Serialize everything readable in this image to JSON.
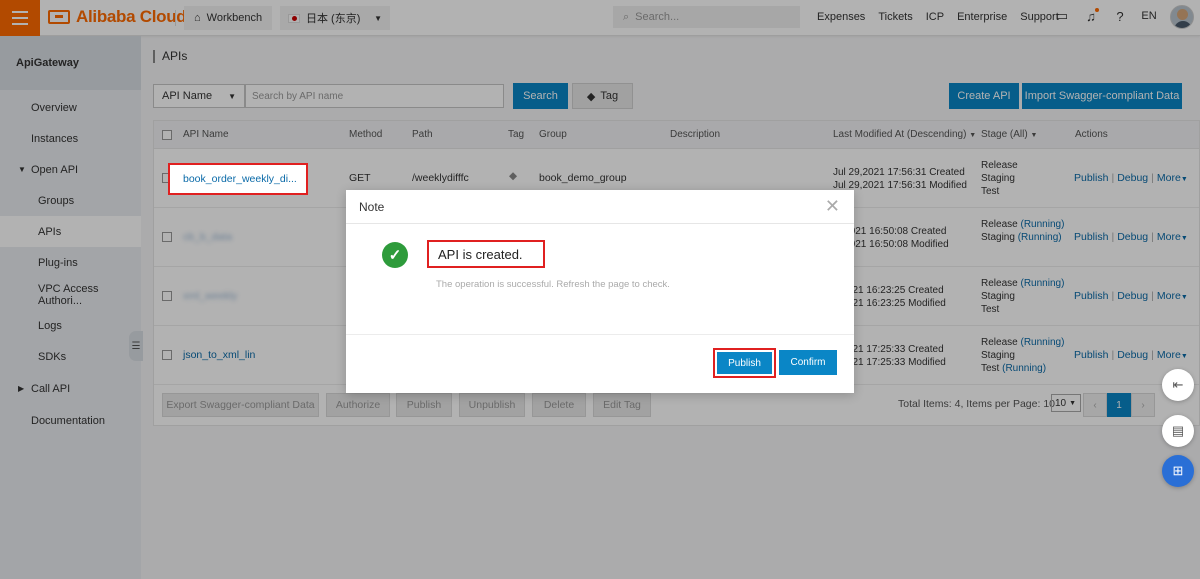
{
  "topbar": {
    "logo": "Alibaba Cloud",
    "workbench": "Workbench",
    "region": "日本 (东京)",
    "search_placeholder": "Search...",
    "links": [
      "Expenses",
      "Tickets",
      "ICP",
      "Enterprise",
      "Support"
    ],
    "lang": "EN"
  },
  "sidebar": {
    "title": "ApiGateway",
    "items": [
      {
        "label": "Overview"
      },
      {
        "label": "Instances"
      },
      {
        "label": "Open API"
      },
      {
        "label": "Groups"
      },
      {
        "label": "APIs"
      },
      {
        "label": "Plug-ins"
      },
      {
        "label": "VPC Access Authori..."
      },
      {
        "label": "Logs"
      },
      {
        "label": "SDKs"
      },
      {
        "label": "Call API"
      },
      {
        "label": "Documentation"
      }
    ]
  },
  "main": {
    "title": "APIs",
    "filter_select": "API Name",
    "filter_placeholder": "Search by API name",
    "search_button": "Search",
    "tag_button": "Tag",
    "create_button": "Create API",
    "import_button": "Import Swagger-compliant Data"
  },
  "table": {
    "columns": [
      "API Name",
      "Method",
      "Path",
      "Tag",
      "Group",
      "Description",
      "Last Modified At (Descending)",
      "Stage (All)",
      "Actions"
    ],
    "rows": [
      {
        "name": "book_order_weekly_di...",
        "method": "GET",
        "path": "/weeklydifffc",
        "group": "book_demo_group",
        "created": "Jul 29,2021 17:56:31 Created",
        "modified": "Jul 29,2021 17:56:31 Modified",
        "stage1": "Release",
        "stage1_status": "",
        "stage2": "Staging",
        "stage2_status": "",
        "stage3": "Test",
        "stage3_status": ""
      },
      {
        "name": "cb_b_data",
        "created": ",0,2021 16:50:08 Created",
        "modified": ",0,2021 16:50:08 Modified",
        "stage1": "Release",
        "stage1_status": "(Running)",
        "stage2": "Staging",
        "stage2_status": "(Running)",
        "stage3": "",
        "stage3_status": ""
      },
      {
        "name": "xml_weekly",
        "created": "5,2021 16:23:25 Created",
        "modified": "5,2021 16:23:25 Modified",
        "stage1": "Release",
        "stage1_status": "(Running)",
        "stage2": "Staging",
        "stage2_status": "",
        "stage3": "Test",
        "stage3_status": ""
      },
      {
        "name": "json_to_xml_lin",
        "created": "0,2021 17:25:33 Created",
        "modified": "0,2021 17:25:33 Modified",
        "stage1": "Release",
        "stage1_status": "(Running)",
        "stage2": "Staging",
        "stage2_status": "",
        "stage3": "Test",
        "stage3_status": "(Running)"
      }
    ],
    "actions": {
      "publish": "Publish",
      "debug": "Debug",
      "more": "More"
    },
    "bulk_buttons": [
      "Export Swagger-compliant Data",
      "Authorize",
      "Publish",
      "Unpublish",
      "Delete",
      "Edit Tag"
    ],
    "pager_info": "Total Items: 4, Items per Page: 10",
    "page_size": "10",
    "current_page": "1",
    "prev": "‹",
    "next": "›"
  },
  "modal": {
    "title": "Note",
    "message": "API is created.",
    "sub": "The operation is successful. Refresh the page to check.",
    "publish": "Publish",
    "confirm": "Confirm"
  },
  "colors": {
    "brand": "#ff6a00",
    "primary": "#0a86c6",
    "success": "#2e9b3b",
    "highlight": "#e02020"
  }
}
